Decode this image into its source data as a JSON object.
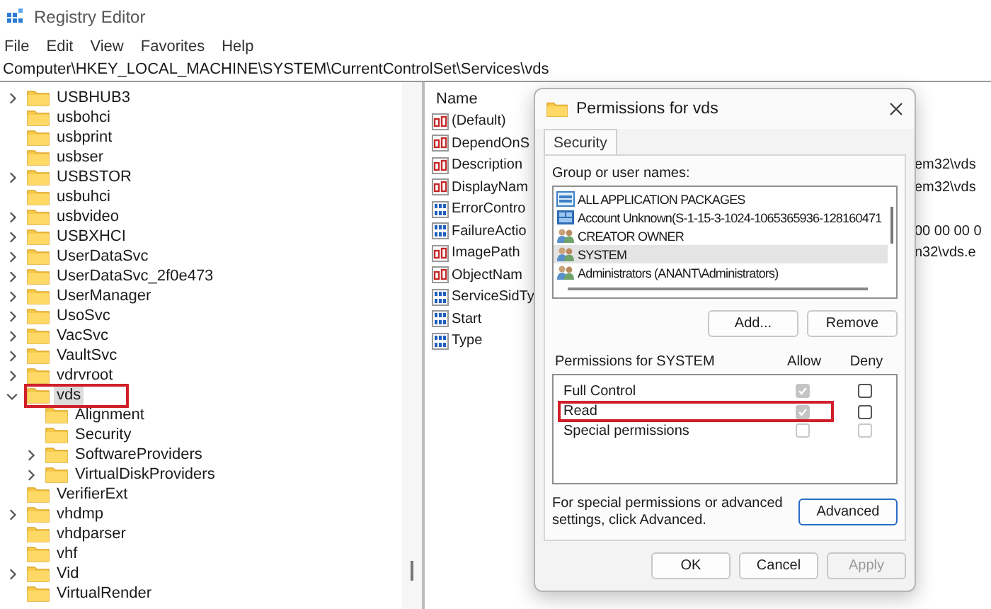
{
  "window": {
    "title": "Registry Editor"
  },
  "menu": [
    "File",
    "Edit",
    "View",
    "Favorites",
    "Help"
  ],
  "address": "Computer\\HKEY_LOCAL_MACHINE\\SYSTEM\\CurrentControlSet\\Services\\vds",
  "tree": {
    "items": [
      {
        "label": "USBHUB3",
        "expanded": false,
        "selected": false,
        "marked": false
      },
      {
        "label": "usbohci",
        "selected": false,
        "marked": false
      },
      {
        "label": "usbprint",
        "selected": false,
        "marked": false
      },
      {
        "label": "usbser",
        "selected": false,
        "marked": false
      },
      {
        "label": "USBSTOR",
        "expanded": false,
        "selected": false,
        "marked": false
      },
      {
        "label": "usbuhci",
        "selected": false,
        "marked": false
      },
      {
        "label": "usbvideo",
        "expanded": false,
        "selected": false,
        "marked": false
      },
      {
        "label": "USBXHCI",
        "expanded": false,
        "selected": false,
        "marked": false
      },
      {
        "label": "UserDataSvc",
        "expanded": false,
        "selected": false,
        "marked": false
      },
      {
        "label": "UserDataSvc_2f0e473",
        "expanded": false,
        "selected": false,
        "marked": false
      },
      {
        "label": "UserManager",
        "expanded": false,
        "selected": false,
        "marked": false
      },
      {
        "label": "UsoSvc",
        "expanded": false,
        "selected": false,
        "marked": false
      },
      {
        "label": "VacSvc",
        "expanded": false,
        "selected": false,
        "marked": false
      },
      {
        "label": "VaultSvc",
        "expanded": false,
        "selected": false,
        "marked": false
      },
      {
        "label": "vdrvroot",
        "expanded": false,
        "selected": false,
        "marked": false
      },
      {
        "label": "vds",
        "expanded": true,
        "selected": true,
        "marked": true,
        "children": [
          {
            "label": "Alignment",
            "selected": false,
            "marked": false
          },
          {
            "label": "Security",
            "selected": false,
            "marked": false
          },
          {
            "label": "SoftwareProviders",
            "expanded": false,
            "selected": false,
            "marked": false
          },
          {
            "label": "VirtualDiskProviders",
            "expanded": false,
            "selected": false,
            "marked": false
          }
        ]
      },
      {
        "label": "VerifierExt",
        "selected": false,
        "marked": false
      },
      {
        "label": "vhdmp",
        "expanded": false,
        "selected": false,
        "marked": false
      },
      {
        "label": "vhdparser",
        "selected": false,
        "marked": false
      },
      {
        "label": "vhf",
        "selected": false,
        "marked": false
      },
      {
        "label": "Vid",
        "expanded": false,
        "selected": false,
        "marked": false
      },
      {
        "label": "VirtualRender",
        "selected": false,
        "marked": false
      }
    ]
  },
  "values": {
    "column": "Name",
    "rows": [
      {
        "kind": "string",
        "name": "(Default)"
      },
      {
        "kind": "string",
        "name": "DependOnS"
      },
      {
        "kind": "string",
        "name": "Description",
        "data": "em32\\vds"
      },
      {
        "kind": "string",
        "name": "DisplayNam",
        "data": "em32\\vds"
      },
      {
        "kind": "binary",
        "name": "ErrorContro"
      },
      {
        "kind": "binary",
        "name": "FailureActio",
        "data": "00 00 00 0"
      },
      {
        "kind": "string",
        "name": "ImagePath",
        "data": "n32\\vds.e"
      },
      {
        "kind": "string",
        "name": "ObjectNam"
      },
      {
        "kind": "binary",
        "name": "ServiceSidTy"
      },
      {
        "kind": "binary",
        "name": "Start"
      },
      {
        "kind": "binary",
        "name": "Type"
      }
    ]
  },
  "dialog": {
    "title": "Permissions for vds",
    "tabs": [
      {
        "label": "Security",
        "selected": true
      }
    ],
    "group_label": "Group or user names:",
    "users": [
      {
        "kind": "package",
        "name": "ALL APPLICATION PACKAGES",
        "selected": false
      },
      {
        "kind": "unknown",
        "name": "Account Unknown(S-1-15-3-1024-1065365936-128160471",
        "selected": false
      },
      {
        "kind": "group",
        "name": "CREATOR OWNER",
        "selected": false
      },
      {
        "kind": "group",
        "name": "SYSTEM",
        "selected": true
      },
      {
        "kind": "group",
        "name": "Administrators (ANANT\\Administrators)",
        "selected": false
      }
    ],
    "user_buttons": [
      "Add...",
      "Remove"
    ],
    "permissions_label": "Permissions for SYSTEM",
    "allow_label": "Allow",
    "deny_label": "Deny",
    "permissions": [
      {
        "name": "Full Control",
        "allow": true,
        "allow_disabled": true,
        "deny": false,
        "deny_disabled": false,
        "marked": false
      },
      {
        "name": "Read",
        "allow": true,
        "allow_disabled": true,
        "deny": false,
        "deny_disabled": false,
        "marked": true
      },
      {
        "name": "Special permissions",
        "allow": false,
        "allow_disabled": true,
        "deny": false,
        "deny_disabled": true,
        "marked": false
      }
    ],
    "advanced_text": "For special permissions or advanced settings, click Advanced.",
    "advanced_button": "Advanced",
    "footer_buttons": [
      {
        "label": "OK",
        "disabled": false
      },
      {
        "label": "Cancel",
        "disabled": false
      },
      {
        "label": "Apply",
        "disabled": true
      }
    ]
  }
}
